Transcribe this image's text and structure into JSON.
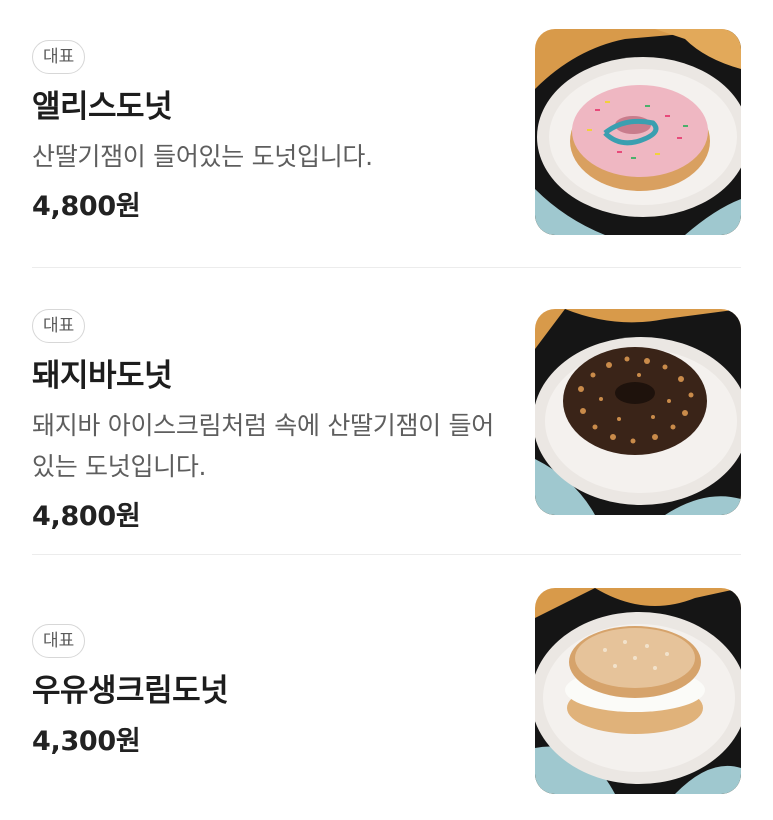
{
  "menu": {
    "items": [
      {
        "badge": "대표",
        "name": "앨리스도넛",
        "description": "산딸기잼이 들어있는 도넛입니다.",
        "price": "4,800원",
        "image": "pink-sprinkle-donut"
      },
      {
        "badge": "대표",
        "name": "돼지바도넛",
        "description": "돼지바 아이스크림처럼 속에 산딸기잼이 들어있는 도넛입니다.",
        "price": "4,800원",
        "image": "chocolate-crunch-donut"
      },
      {
        "badge": "대표",
        "name": "우유생크림도넛",
        "description": "",
        "price": "4,300원",
        "image": "cream-filled-donut"
      }
    ]
  },
  "colors": {
    "table_wood": "#d89a4a",
    "plate": "#eeeae6",
    "cloth_blue": "#9fc8cf",
    "cloth_black": "#141414"
  }
}
